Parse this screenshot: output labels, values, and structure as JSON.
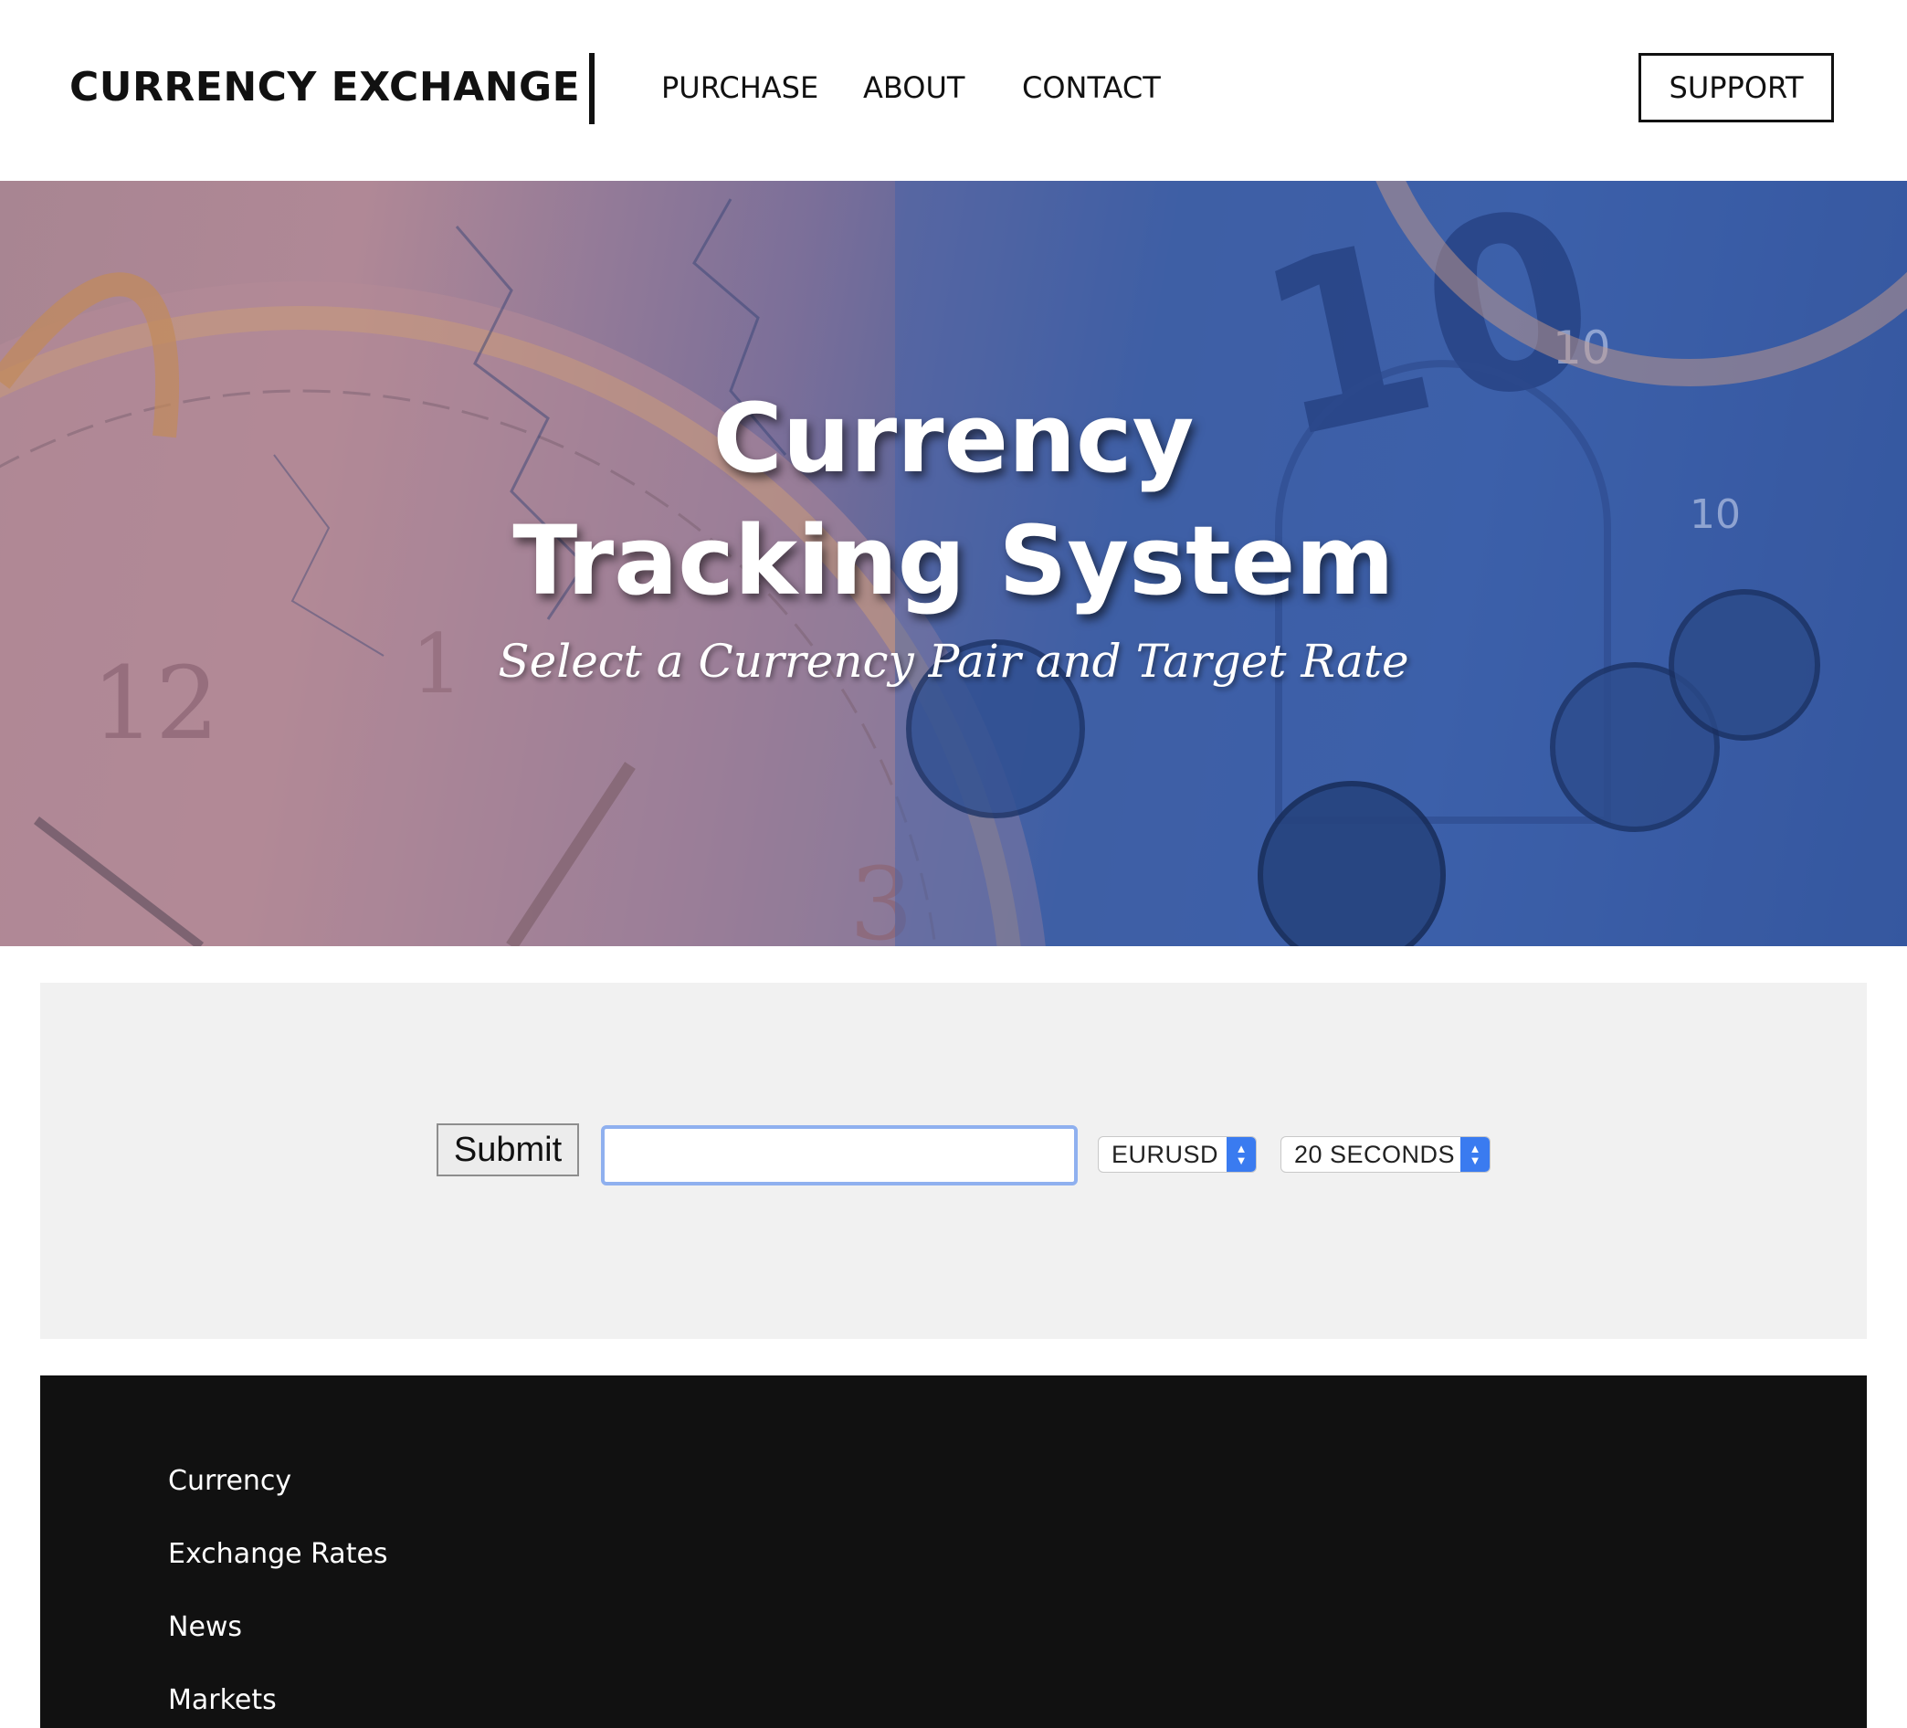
{
  "header": {
    "brand": "CURRENCY EXCHANGE",
    "nav": [
      "PURCHASE",
      "ABOUT",
      "CONTACT"
    ],
    "support_label": "SUPPORT"
  },
  "hero": {
    "title_line1": "Currency",
    "title_line2": "Tracking System",
    "subtitle": "Select a Currency Pair and Target Rate"
  },
  "form": {
    "submit_label": "Submit",
    "target_rate_value": "",
    "currency_pair_selected": "EURUSD",
    "interval_selected": "20 SECONDS",
    "accent_color": "#3a7bf0",
    "input_focus_color": "#8fb0ef"
  },
  "footer": {
    "links": [
      "Currency",
      "Exchange Rates",
      "News",
      "Markets"
    ]
  },
  "colors": {
    "panel_bg": "#f1f1f1",
    "footer_bg": "#111111"
  }
}
